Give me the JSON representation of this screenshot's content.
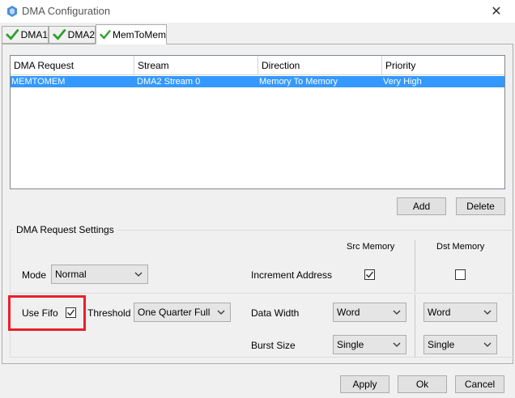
{
  "window": {
    "title": "DMA Configuration",
    "close_glyph": "✕"
  },
  "tabs": [
    {
      "label": "DMA1",
      "icon": "check-icon"
    },
    {
      "label": "DMA2",
      "icon": "check-icon"
    },
    {
      "label": "MemToMem",
      "icon": "check-icon",
      "active": true
    }
  ],
  "table": {
    "columns": [
      "DMA Request",
      "Stream",
      "Direction",
      "Priority"
    ],
    "rows": [
      {
        "request": "MEMTOMEM",
        "stream": "DMA2 Stream 0",
        "direction": "Memory To Memory",
        "priority": "Very High",
        "selected": true
      }
    ]
  },
  "buttons": {
    "add": "Add",
    "delete": "Delete",
    "apply": "Apply",
    "ok": "Ok",
    "cancel": "Cancel"
  },
  "settings": {
    "group_title": "DMA Request Settings",
    "src_header": "Src Memory",
    "dst_header": "Dst Memory",
    "mode_label": "Mode",
    "mode_value": "Normal",
    "increment_label": "Increment Address",
    "src_increment": true,
    "dst_increment": false,
    "fifo_label": "Use Fifo",
    "fifo_checked": true,
    "threshold_label": "Threshold",
    "threshold_value": "One Quarter Full",
    "data_width_label": "Data Width",
    "src_data_width": "Word",
    "dst_data_width": "Word",
    "burst_label": "Burst Size",
    "src_burst": "Single",
    "dst_burst": "Single"
  },
  "colors": {
    "selection": "#3399ff",
    "highlight": "#e8202a",
    "check": "#2e9e2e"
  }
}
